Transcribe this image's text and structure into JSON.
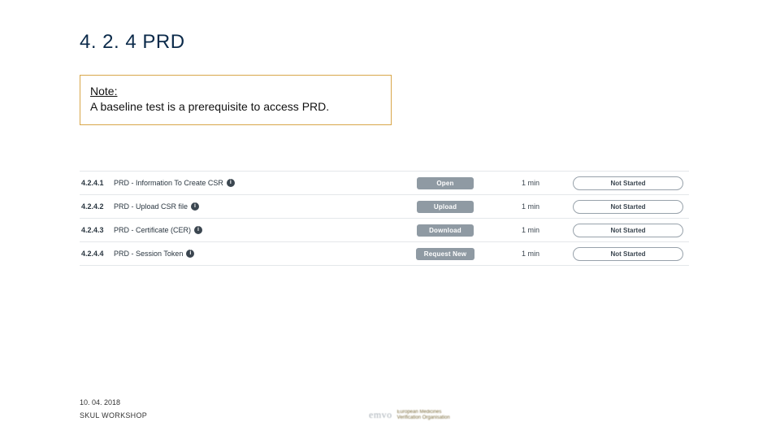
{
  "title": "4. 2. 4 PRD",
  "note": {
    "label": "Note:",
    "text": "A baseline test is a prerequisite to access PRD."
  },
  "rows": [
    {
      "idx": "4.2.4.1",
      "name": "PRD - Information To Create CSR",
      "action": "Open",
      "time": "1 min",
      "status": "Not Started"
    },
    {
      "idx": "4.2.4.2",
      "name": "PRD - Upload CSR file",
      "action": "Upload",
      "time": "1 min",
      "status": "Not Started"
    },
    {
      "idx": "4.2.4.3",
      "name": "PRD - Certificate (CER)",
      "action": "Download",
      "time": "1 min",
      "status": "Not Started"
    },
    {
      "idx": "4.2.4.4",
      "name": "PRD - Session Token",
      "action": "Request New",
      "time": "1 min",
      "status": "Not Started"
    }
  ],
  "footer": {
    "date": "10. 04. 2018",
    "sub": "SKUL WORKSHOP"
  },
  "logo": {
    "mark": "emvo",
    "line1": "European Medicines",
    "line2": "Verification Organisation"
  }
}
